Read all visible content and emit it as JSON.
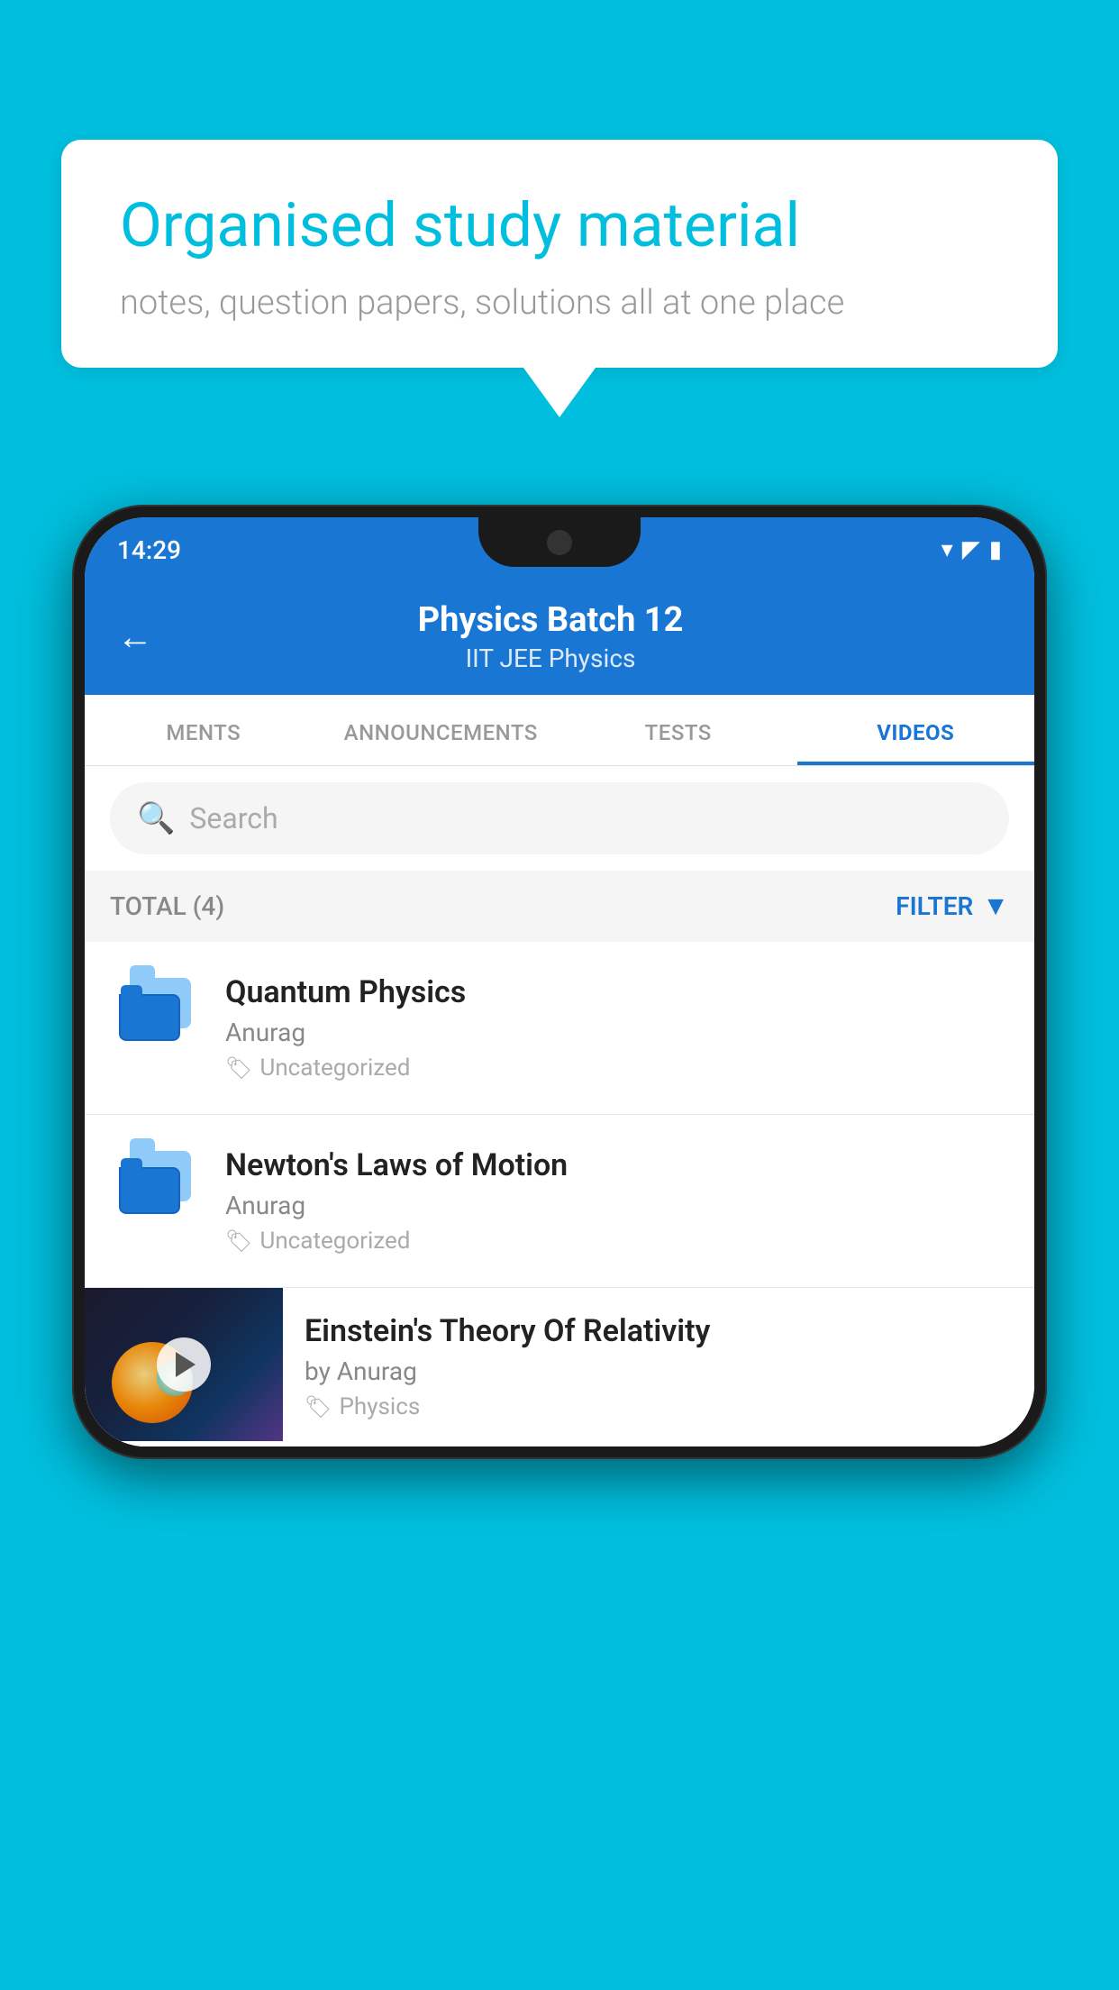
{
  "background_color": "#00BFDE",
  "speech_bubble": {
    "title": "Organised study material",
    "subtitle": "notes, question papers, solutions all at one place"
  },
  "phone": {
    "status_bar": {
      "time": "14:29",
      "wifi_icon": "▾",
      "signal_icon": "▲",
      "battery_icon": "▮"
    },
    "app_bar": {
      "back_label": "←",
      "title": "Physics Batch 12",
      "subtitle": "IIT JEE   Physics"
    },
    "tabs": [
      {
        "label": "MENTS",
        "active": false
      },
      {
        "label": "ANNOUNCEMENTS",
        "active": false
      },
      {
        "label": "TESTS",
        "active": false
      },
      {
        "label": "VIDEOS",
        "active": true
      }
    ],
    "search": {
      "placeholder": "Search"
    },
    "filter_bar": {
      "total_label": "TOTAL (4)",
      "filter_label": "FILTER"
    },
    "videos": [
      {
        "title": "Quantum Physics",
        "author": "Anurag",
        "tag": "Uncategorized",
        "has_thumb": false
      },
      {
        "title": "Newton's Laws of Motion",
        "author": "Anurag",
        "tag": "Uncategorized",
        "has_thumb": false
      },
      {
        "title": "Einstein's Theory Of Relativity",
        "author": "by Anurag",
        "tag": "Physics",
        "has_thumb": true
      }
    ]
  }
}
